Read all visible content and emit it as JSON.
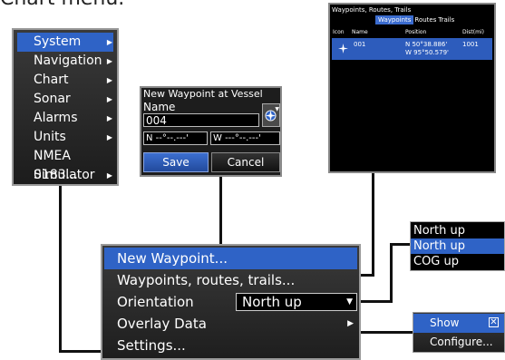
{
  "heading": "Chart menu.",
  "system_menu": {
    "items": [
      {
        "label": "System",
        "arrow": "▶"
      },
      {
        "label": "Navigation",
        "arrow": "▶"
      },
      {
        "label": "Chart",
        "arrow": "▶"
      },
      {
        "label": "Sonar",
        "arrow": "▶"
      },
      {
        "label": "Alarms",
        "arrow": "▶"
      },
      {
        "label": "Units",
        "arrow": "▶"
      },
      {
        "label": "NMEA 0183...",
        "arrow": ""
      },
      {
        "label": "Simulator",
        "arrow": "▶"
      }
    ]
  },
  "new_waypoint_dialog": {
    "title": "New Waypoint at Vessel",
    "name_label": "Name",
    "name_value": "004",
    "lat_value": "N  --°--.---'",
    "lon_value": "W  ---°--.---'",
    "icon_arrow": "▼",
    "save": "Save",
    "cancel": "Cancel"
  },
  "waypoints_screen": {
    "title": "Waypoints, Routes, Trails",
    "tabs": [
      "Waypoints",
      "Routes",
      "Trails"
    ],
    "columns": {
      "icon": "Icon",
      "name": "Name",
      "position": "Position",
      "dist": "Dist(mi)"
    },
    "rows": [
      {
        "name": "001",
        "lat": "N  50°38.886'",
        "lon": "W  95°50.579'",
        "dist": "1001"
      }
    ]
  },
  "main_menu": {
    "items": [
      {
        "label": "New Waypoint..."
      },
      {
        "label": "Waypoints, routes, trails..."
      },
      {
        "label": "Orientation"
      },
      {
        "label": "Overlay Data"
      },
      {
        "label": "Settings..."
      }
    ],
    "orientation_value": "North up",
    "dropdown_arrow": "▼",
    "submenu_arrow": "▶"
  },
  "orientation_dropdown": {
    "options": [
      "North up",
      "North up",
      "COG up"
    ]
  },
  "overlay_submenu": {
    "items": [
      "Show",
      "Configure..."
    ],
    "check": "✕"
  }
}
